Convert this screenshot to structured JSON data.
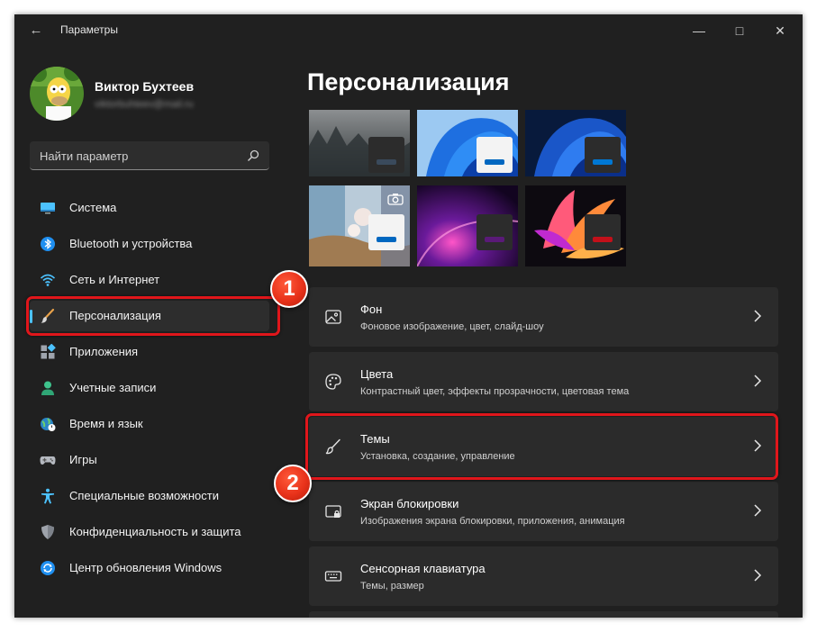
{
  "window": {
    "title": "Параметры"
  },
  "user": {
    "name": "Виктор Бухтеев",
    "email": "viktorbuhteev@mail.ru"
  },
  "search": {
    "placeholder": "Найти параметр"
  },
  "sidebar": {
    "items": [
      {
        "label": "Система",
        "icon": "monitor-icon"
      },
      {
        "label": "Bluetooth и устройства",
        "icon": "bluetooth-icon"
      },
      {
        "label": "Сеть и Интернет",
        "icon": "wifi-icon"
      },
      {
        "label": "Персонализация",
        "icon": "brush-icon",
        "active": true
      },
      {
        "label": "Приложения",
        "icon": "apps-icon"
      },
      {
        "label": "Учетные записи",
        "icon": "person-icon"
      },
      {
        "label": "Время и язык",
        "icon": "globe-clock-icon"
      },
      {
        "label": "Игры",
        "icon": "gamepad-icon"
      },
      {
        "label": "Специальные возможности",
        "icon": "accessibility-icon"
      },
      {
        "label": "Конфиденциальность и защита",
        "icon": "shield-icon"
      },
      {
        "label": "Центр обновления Windows",
        "icon": "update-icon"
      }
    ]
  },
  "main": {
    "title": "Персонализация",
    "themes": [
      {
        "name": "foggy-forest",
        "accent": "#3a4a5c"
      },
      {
        "name": "bloom-light",
        "accent": "#0067c0"
      },
      {
        "name": "bloom-dark",
        "accent": "#0078d4"
      },
      {
        "name": "captured-motion",
        "accent": "#0067c0"
      },
      {
        "name": "glow",
        "accent": "#5a1a78"
      },
      {
        "name": "sunrise",
        "accent": "#c2101a"
      }
    ],
    "cards": [
      {
        "title": "Фон",
        "subtitle": "Фоновое изображение, цвет, слайд-шоу",
        "icon": "image-icon"
      },
      {
        "title": "Цвета",
        "subtitle": "Контрастный цвет, эффекты прозрачности, цветовая тема",
        "icon": "palette-icon"
      },
      {
        "title": "Темы",
        "subtitle": "Установка, создание, управление",
        "icon": "brush-icon"
      },
      {
        "title": "Экран блокировки",
        "subtitle": "Изображения экрана блокировки, приложения, анимация",
        "icon": "lock-screen-icon"
      },
      {
        "title": "Сенсорная клавиатура",
        "subtitle": "Темы, размер",
        "icon": "keyboard-icon"
      }
    ]
  },
  "annotations": {
    "badge1": "1",
    "badge2": "2",
    "color": "#e0161b"
  }
}
